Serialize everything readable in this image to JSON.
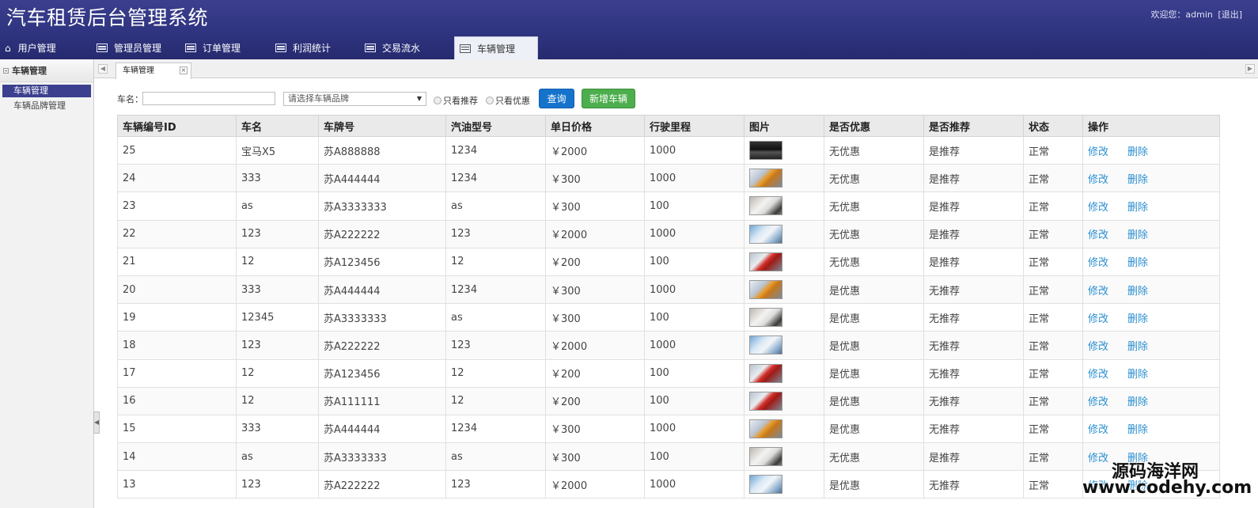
{
  "app_title": "汽车租赁后台管理系统",
  "welcome": {
    "prefix": "欢迎您：admin",
    "logout": "[退出]"
  },
  "topnav": [
    {
      "label": "用户管理"
    },
    {
      "label": "管理员管理"
    },
    {
      "label": "订单管理"
    },
    {
      "label": "利润统计"
    },
    {
      "label": "交易流水"
    },
    {
      "label": "车辆管理"
    }
  ],
  "sidebar": {
    "header": "车辆管理",
    "items": [
      {
        "label": "车辆管理"
      },
      {
        "label": "车辆品牌管理"
      }
    ]
  },
  "page_tab": {
    "label": "车辆管理"
  },
  "filter": {
    "name_label": "车名：",
    "name_value": "",
    "brand_placeholder": "请选择车辆品牌",
    "only_recommend": "只看推荐",
    "only_discount": "只看优惠",
    "query_button": "查询",
    "add_button": "新增车辆"
  },
  "table": {
    "headers": [
      "车辆编号ID",
      "车名",
      "车牌号",
      "汽油型号",
      "单日价格",
      "行驶里程",
      "图片",
      "是否优惠",
      "是否推荐",
      "状态",
      "操作"
    ],
    "edit_label": "修改",
    "delete_label": "删除",
    "rows": [
      {
        "id": "25",
        "name": "宝马X5",
        "plate": "苏A888888",
        "fuel": "1234",
        "price": "￥2000",
        "mileage": "1000",
        "image": "car-black",
        "discount": "无优惠",
        "recommend": "是推荐",
        "status": "正常"
      },
      {
        "id": "24",
        "name": "333",
        "plate": "苏A444444",
        "fuel": "1234",
        "price": "￥300",
        "mileage": "1000",
        "image": "car-orange",
        "discount": "无优惠",
        "recommend": "是推荐",
        "status": "正常"
      },
      {
        "id": "23",
        "name": "as",
        "plate": "苏A3333333",
        "fuel": "as",
        "price": "￥300",
        "mileage": "100",
        "image": "car-white",
        "discount": "无优惠",
        "recommend": "是推荐",
        "status": "正常"
      },
      {
        "id": "22",
        "name": "123",
        "plate": "苏A222222",
        "fuel": "123",
        "price": "￥2000",
        "mileage": "1000",
        "image": "car-silver",
        "discount": "无优惠",
        "recommend": "是推荐",
        "status": "正常"
      },
      {
        "id": "21",
        "name": "12",
        "plate": "苏A123456",
        "fuel": "12",
        "price": "￥200",
        "mileage": "100",
        "image": "car-red",
        "discount": "无优惠",
        "recommend": "是推荐",
        "status": "正常"
      },
      {
        "id": "20",
        "name": "333",
        "plate": "苏A444444",
        "fuel": "1234",
        "price": "￥300",
        "mileage": "1000",
        "image": "car-orange",
        "discount": "是优惠",
        "recommend": "无推荐",
        "status": "正常"
      },
      {
        "id": "19",
        "name": "12345",
        "plate": "苏A3333333",
        "fuel": "as",
        "price": "￥300",
        "mileage": "100",
        "image": "car-white",
        "discount": "是优惠",
        "recommend": "无推荐",
        "status": "正常"
      },
      {
        "id": "18",
        "name": "123",
        "plate": "苏A222222",
        "fuel": "123",
        "price": "￥2000",
        "mileage": "1000",
        "image": "car-silver",
        "discount": "是优惠",
        "recommend": "无推荐",
        "status": "正常"
      },
      {
        "id": "17",
        "name": "12",
        "plate": "苏A123456",
        "fuel": "12",
        "price": "￥200",
        "mileage": "100",
        "image": "car-red",
        "discount": "是优惠",
        "recommend": "无推荐",
        "status": "正常"
      },
      {
        "id": "16",
        "name": "12",
        "plate": "苏A111111",
        "fuel": "12",
        "price": "￥200",
        "mileage": "100",
        "image": "car-red",
        "discount": "是优惠",
        "recommend": "无推荐",
        "status": "正常"
      },
      {
        "id": "15",
        "name": "333",
        "plate": "苏A444444",
        "fuel": "1234",
        "price": "￥300",
        "mileage": "1000",
        "image": "car-orange",
        "discount": "是优惠",
        "recommend": "无推荐",
        "status": "正常"
      },
      {
        "id": "14",
        "name": "as",
        "plate": "苏A3333333",
        "fuel": "as",
        "price": "￥300",
        "mileage": "100",
        "image": "car-white",
        "discount": "无优惠",
        "recommend": "是推荐",
        "status": "正常"
      },
      {
        "id": "13",
        "name": "123",
        "plate": "苏A222222",
        "fuel": "123",
        "price": "￥2000",
        "mileage": "1000",
        "image": "car-silver",
        "discount": "是优惠",
        "recommend": "无推荐",
        "status": "正常"
      }
    ]
  },
  "watermark": {
    "line1": "源码海洋网",
    "line2": "www.codehy.com"
  }
}
